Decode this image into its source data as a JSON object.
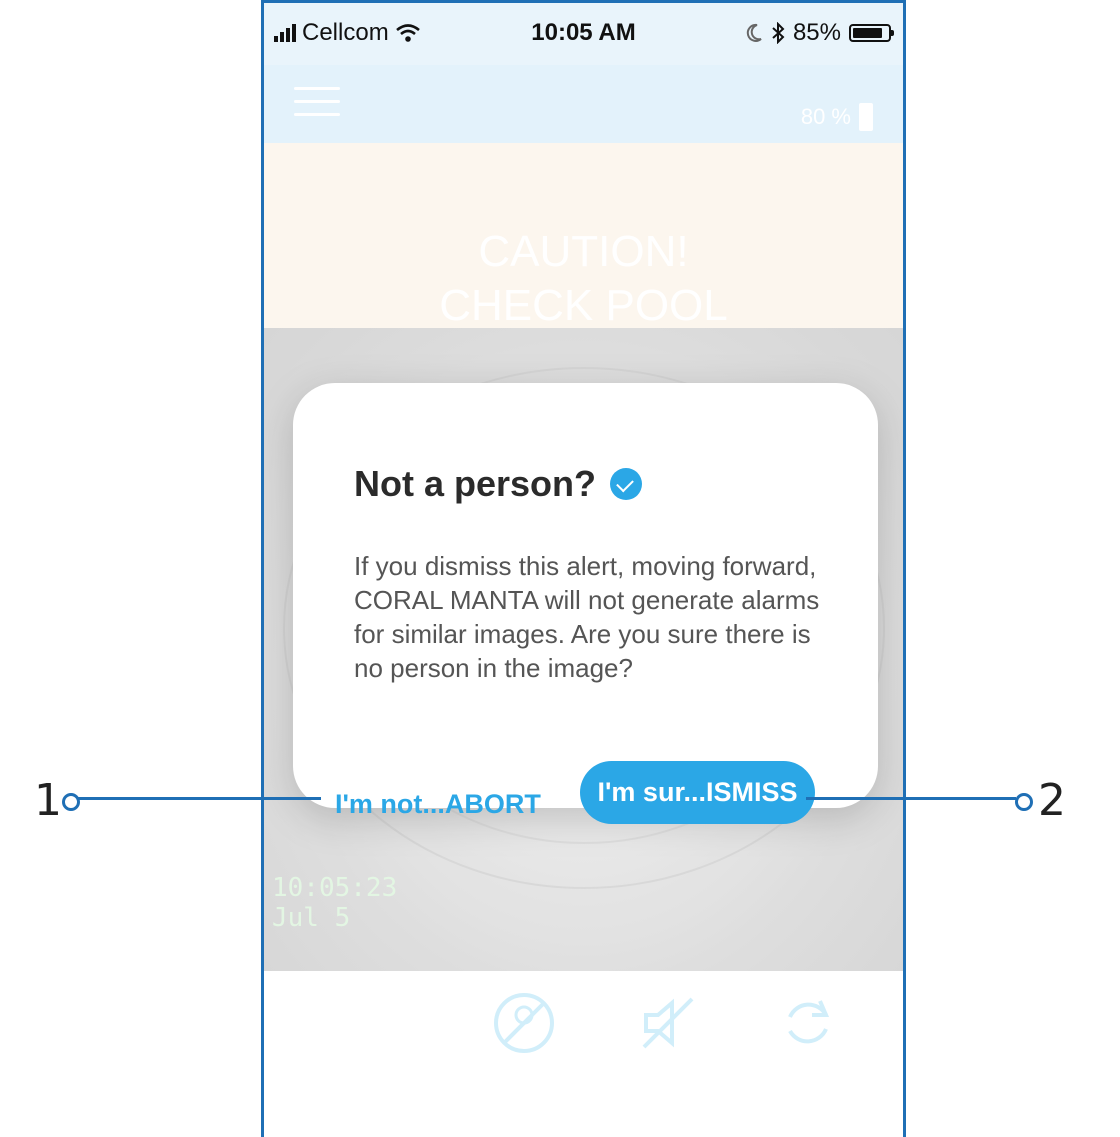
{
  "status_bar": {
    "carrier": "Cellcom",
    "time": "10:05 AM",
    "battery": "85%",
    "battery_level": 0.85
  },
  "app_bar": {
    "menu_icon": "hamburger-icon",
    "battery_label": "80 %"
  },
  "caution": {
    "line1": "CAUTION!",
    "line2": "CHECK POOL"
  },
  "camera": {
    "time": "10:05:23",
    "date": "Jul  5"
  },
  "dialog": {
    "title": "Not a person?",
    "body": "If you dismiss this alert, moving forward, CORAL MANTA will not generate alarms for similar images. Are you sure there is no person in the image?",
    "abort_label": "I'm not...ABORT",
    "dismiss_label": "I'm sur...ISMISS"
  },
  "bottom_icons": [
    "no-person-icon",
    "mute-icon",
    "refresh-icon"
  ],
  "callouts": {
    "left": "1",
    "right": "2"
  },
  "colors": {
    "accent": "#2ba7e6",
    "frame": "#1f6fb5"
  }
}
